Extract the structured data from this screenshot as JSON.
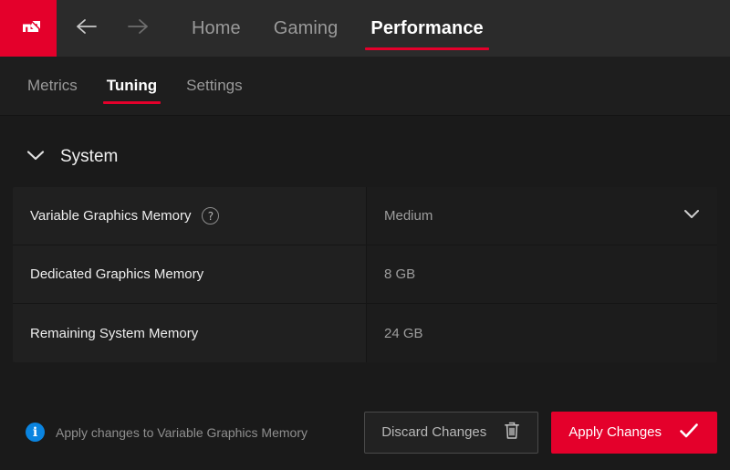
{
  "app": {
    "brand": "AMD",
    "logo_icon": "amd-arrow-logo"
  },
  "topbar": {
    "back_icon": "arrow-left-icon",
    "forward_icon": "arrow-right-icon",
    "nav": [
      {
        "label": "Home",
        "active": false
      },
      {
        "label": "Gaming",
        "active": false
      },
      {
        "label": "Performance",
        "active": true
      }
    ]
  },
  "subtabs": [
    {
      "label": "Metrics",
      "active": false
    },
    {
      "label": "Tuning",
      "active": true
    },
    {
      "label": "Settings",
      "active": false
    }
  ],
  "section": {
    "title": "System",
    "collapse_icon": "chevron-down-icon",
    "expanded": true
  },
  "settings_rows": [
    {
      "label": "Variable Graphics Memory",
      "help_icon": "question-circle-icon",
      "value": "Medium",
      "control": "dropdown",
      "dropdown_icon": "chevron-down-icon"
    },
    {
      "label": "Dedicated Graphics Memory",
      "help_icon": null,
      "value": "8 GB",
      "control": "readonly",
      "dropdown_icon": null
    },
    {
      "label": "Remaining System Memory",
      "help_icon": null,
      "value": "24 GB",
      "control": "readonly",
      "dropdown_icon": null
    }
  ],
  "footer": {
    "info_icon": "info-circle-icon",
    "note": "Apply changes to Variable Graphics Memory",
    "discard_label": "Discard Changes",
    "discard_icon": "trash-icon",
    "apply_label": "Apply Changes",
    "apply_icon": "check-icon"
  },
  "colors": {
    "brand_red": "#E4002B",
    "info_blue": "#0A84E0",
    "topbar_bg": "#2B2B2B",
    "subbar_bg": "#1E1E1E",
    "body_bg": "#1A1A1A",
    "row_label_bg": "#202020",
    "row_value_bg": "#1C1C1C"
  }
}
